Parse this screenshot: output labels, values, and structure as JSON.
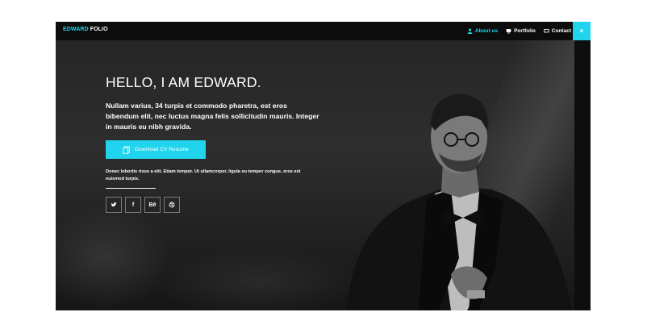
{
  "brand": {
    "first": "EDWARD",
    "second": "FOLIO"
  },
  "nav": {
    "items": [
      {
        "label": "About us",
        "icon": "user-icon",
        "active": true
      },
      {
        "label": "Portfolio",
        "icon": "monitor-icon",
        "active": false
      },
      {
        "label": "Contact",
        "icon": "chat-icon",
        "active": false
      }
    ],
    "close": "×"
  },
  "hero": {
    "headline": "HELLO, I AM EDWARD.",
    "lead": "Nullam varius, 34 turpis et commodo pharetra, est eros bibendum elit, nec luctus magna felis sollicitudin mauris. Integer in mauris eu nibh gravida.",
    "cv_button": "Download CV Resume",
    "small_text": "Donec lobortis risus a elit. Etiam tempor. Ut ullamcorper, ligula eu tempor congue, eros est euismod turpis.",
    "socials": [
      {
        "name": "twitter-icon",
        "glyph": ""
      },
      {
        "name": "facebook-icon",
        "glyph": "f"
      },
      {
        "name": "behance-icon",
        "glyph": "Bē"
      },
      {
        "name": "dribbble-icon",
        "glyph": ""
      }
    ]
  },
  "colors": {
    "accent": "#21d4ee",
    "background": "#0b0b0b"
  }
}
